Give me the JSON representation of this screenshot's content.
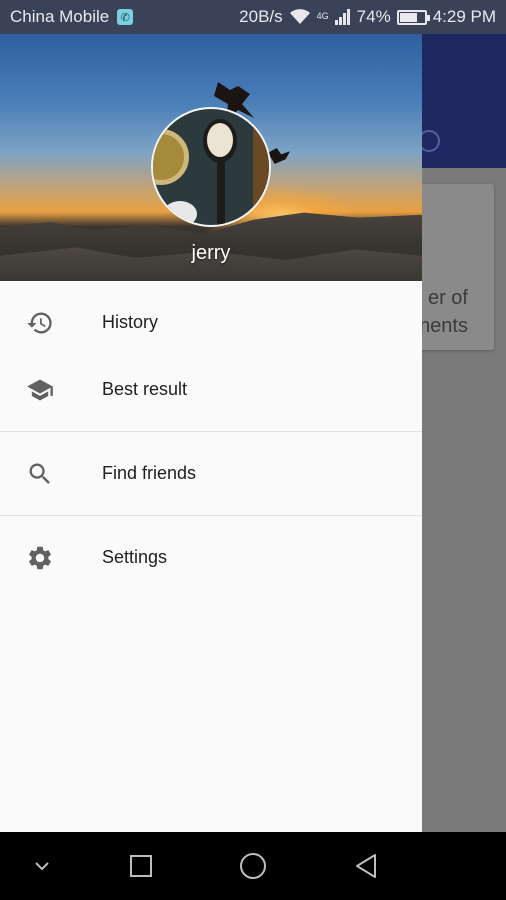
{
  "status_bar": {
    "carrier": "China Mobile",
    "network_speed": "20B/s",
    "network_type": "4G",
    "battery": "74%",
    "battery_level": 0.74,
    "time": "4:29 PM"
  },
  "background_app": {
    "card_text_line1": "er of",
    "card_text_line2": "nents"
  },
  "drawer": {
    "username": "jerry",
    "sections": [
      {
        "items": [
          {
            "label": "History",
            "icon": "history-icon"
          },
          {
            "label": "Best result",
            "icon": "school-icon"
          }
        ]
      },
      {
        "items": [
          {
            "label": "Find friends",
            "icon": "search-icon"
          }
        ]
      },
      {
        "items": [
          {
            "label": "Settings",
            "icon": "gear-icon"
          }
        ]
      }
    ]
  },
  "nav_bar": {
    "buttons": [
      "chevron-down-icon",
      "recents-icon",
      "home-icon",
      "back-icon"
    ]
  }
}
